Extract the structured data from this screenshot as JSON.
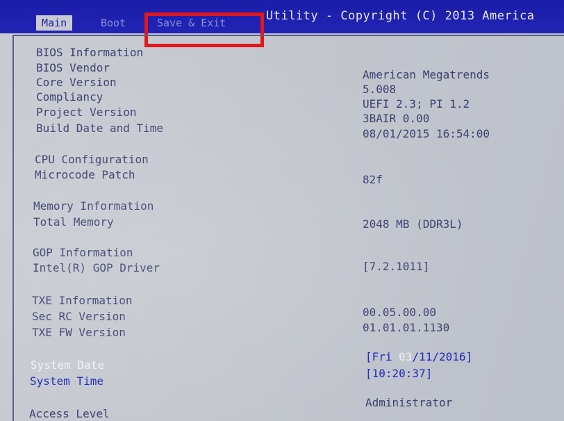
{
  "header": {
    "title": "Utility - Copyright (C) 2013 America",
    "tabs": [
      {
        "label": "Main"
      },
      {
        "label": "Boot"
      },
      {
        "label": "Save & Exit"
      }
    ]
  },
  "sections": {
    "bios_info": "BIOS Information",
    "cpu_config": "CPU Configuration",
    "memory_info": "Memory Information",
    "gop_info": "GOP Information",
    "txe_info": "TXE Information"
  },
  "rows": {
    "bios_vendor": {
      "label": "BIOS Vendor",
      "value": "American Megatrends"
    },
    "core_version": {
      "label": "Core Version",
      "value": "5.008"
    },
    "compliancy": {
      "label": "Compliancy",
      "value": "UEFI 2.3; PI 1.2"
    },
    "project_version": {
      "label": "Project Version",
      "value": "3BAIR 0.00"
    },
    "build_date": {
      "label": "Build Date and Time",
      "value": "08/01/2015 16:54:00"
    },
    "microcode_patch": {
      "label": "Microcode Patch",
      "value": "82f"
    },
    "total_memory": {
      "label": "Total Memory",
      "value": "2048 MB (DDR3L)"
    },
    "gop_driver": {
      "label": "Intel(R) GOP Driver",
      "value": "[7.2.1011]"
    },
    "sec_rc_version": {
      "label": "Sec RC Version",
      "value": "00.05.00.00"
    },
    "txe_fw_version": {
      "label": "TXE FW Version",
      "value": "01.01.01.1130"
    },
    "access_level": {
      "label": "Access Level",
      "value": "Administrator"
    }
  },
  "system_date": {
    "label": "System Date",
    "prefix": "[Fri ",
    "month": "03",
    "suffix": "/11/2016]"
  },
  "system_time": {
    "label": "System Time",
    "value": "[10:20:37]"
  },
  "colors": {
    "header_bg": "#2224b4",
    "screen_bg": "#c6c9d0",
    "text": "#3a3f6e",
    "selected_text": "#f1f2f7",
    "editable_text": "#1c26b8",
    "annotation_red": "#e3161b"
  }
}
